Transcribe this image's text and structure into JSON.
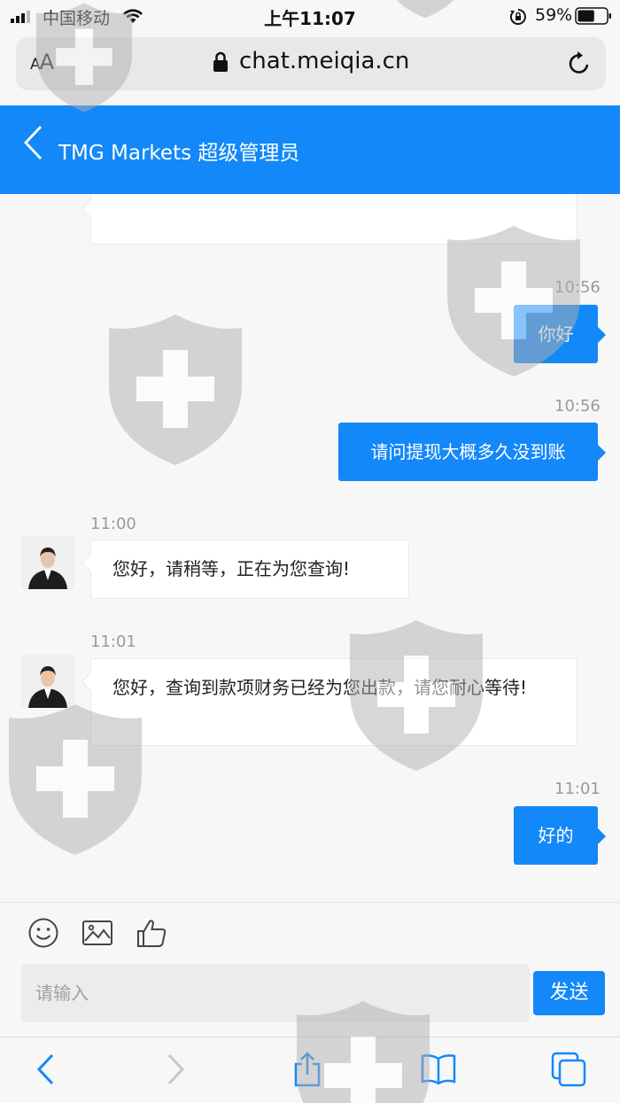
{
  "status_bar": {
    "carrier": "中国移动",
    "time": "上午11:07",
    "battery_percent": "59%",
    "battery_level": 0.59
  },
  "url_bar": {
    "aa_label_a": "A",
    "aa_label_b": "A",
    "url": "chat.meiqia.cn"
  },
  "header": {
    "title": "TMG Markets 超级管理员"
  },
  "messages": [
    {
      "side": "right",
      "time": "10:56",
      "text": "你好"
    },
    {
      "side": "right",
      "time": "10:56",
      "text": "请问提现大概多久没到账"
    },
    {
      "side": "left",
      "time": "11:00",
      "text": "您好，请稍等，正在为您查询!"
    },
    {
      "side": "left",
      "time": "11:01",
      "text": "您好，查询到款项财务已经为您出款，请您耐心等待!"
    },
    {
      "side": "right",
      "time": "11:01",
      "text": "好的"
    }
  ],
  "input": {
    "placeholder": "请输入",
    "send_label": "发送"
  },
  "colors": {
    "accent": "#1388f8",
    "background": "#f7f7f7"
  },
  "icons": {
    "status": [
      "signal-icon",
      "wifi-icon",
      "orientation-lock-icon",
      "battery-icon"
    ],
    "url_bar": [
      "lock-icon",
      "reload-icon"
    ],
    "composer": [
      "emoji-icon",
      "image-icon",
      "thumbs-up-icon"
    ],
    "toolbar": [
      "back-arrow-icon",
      "forward-arrow-icon",
      "share-icon",
      "bookmarks-icon",
      "tabs-icon"
    ]
  }
}
